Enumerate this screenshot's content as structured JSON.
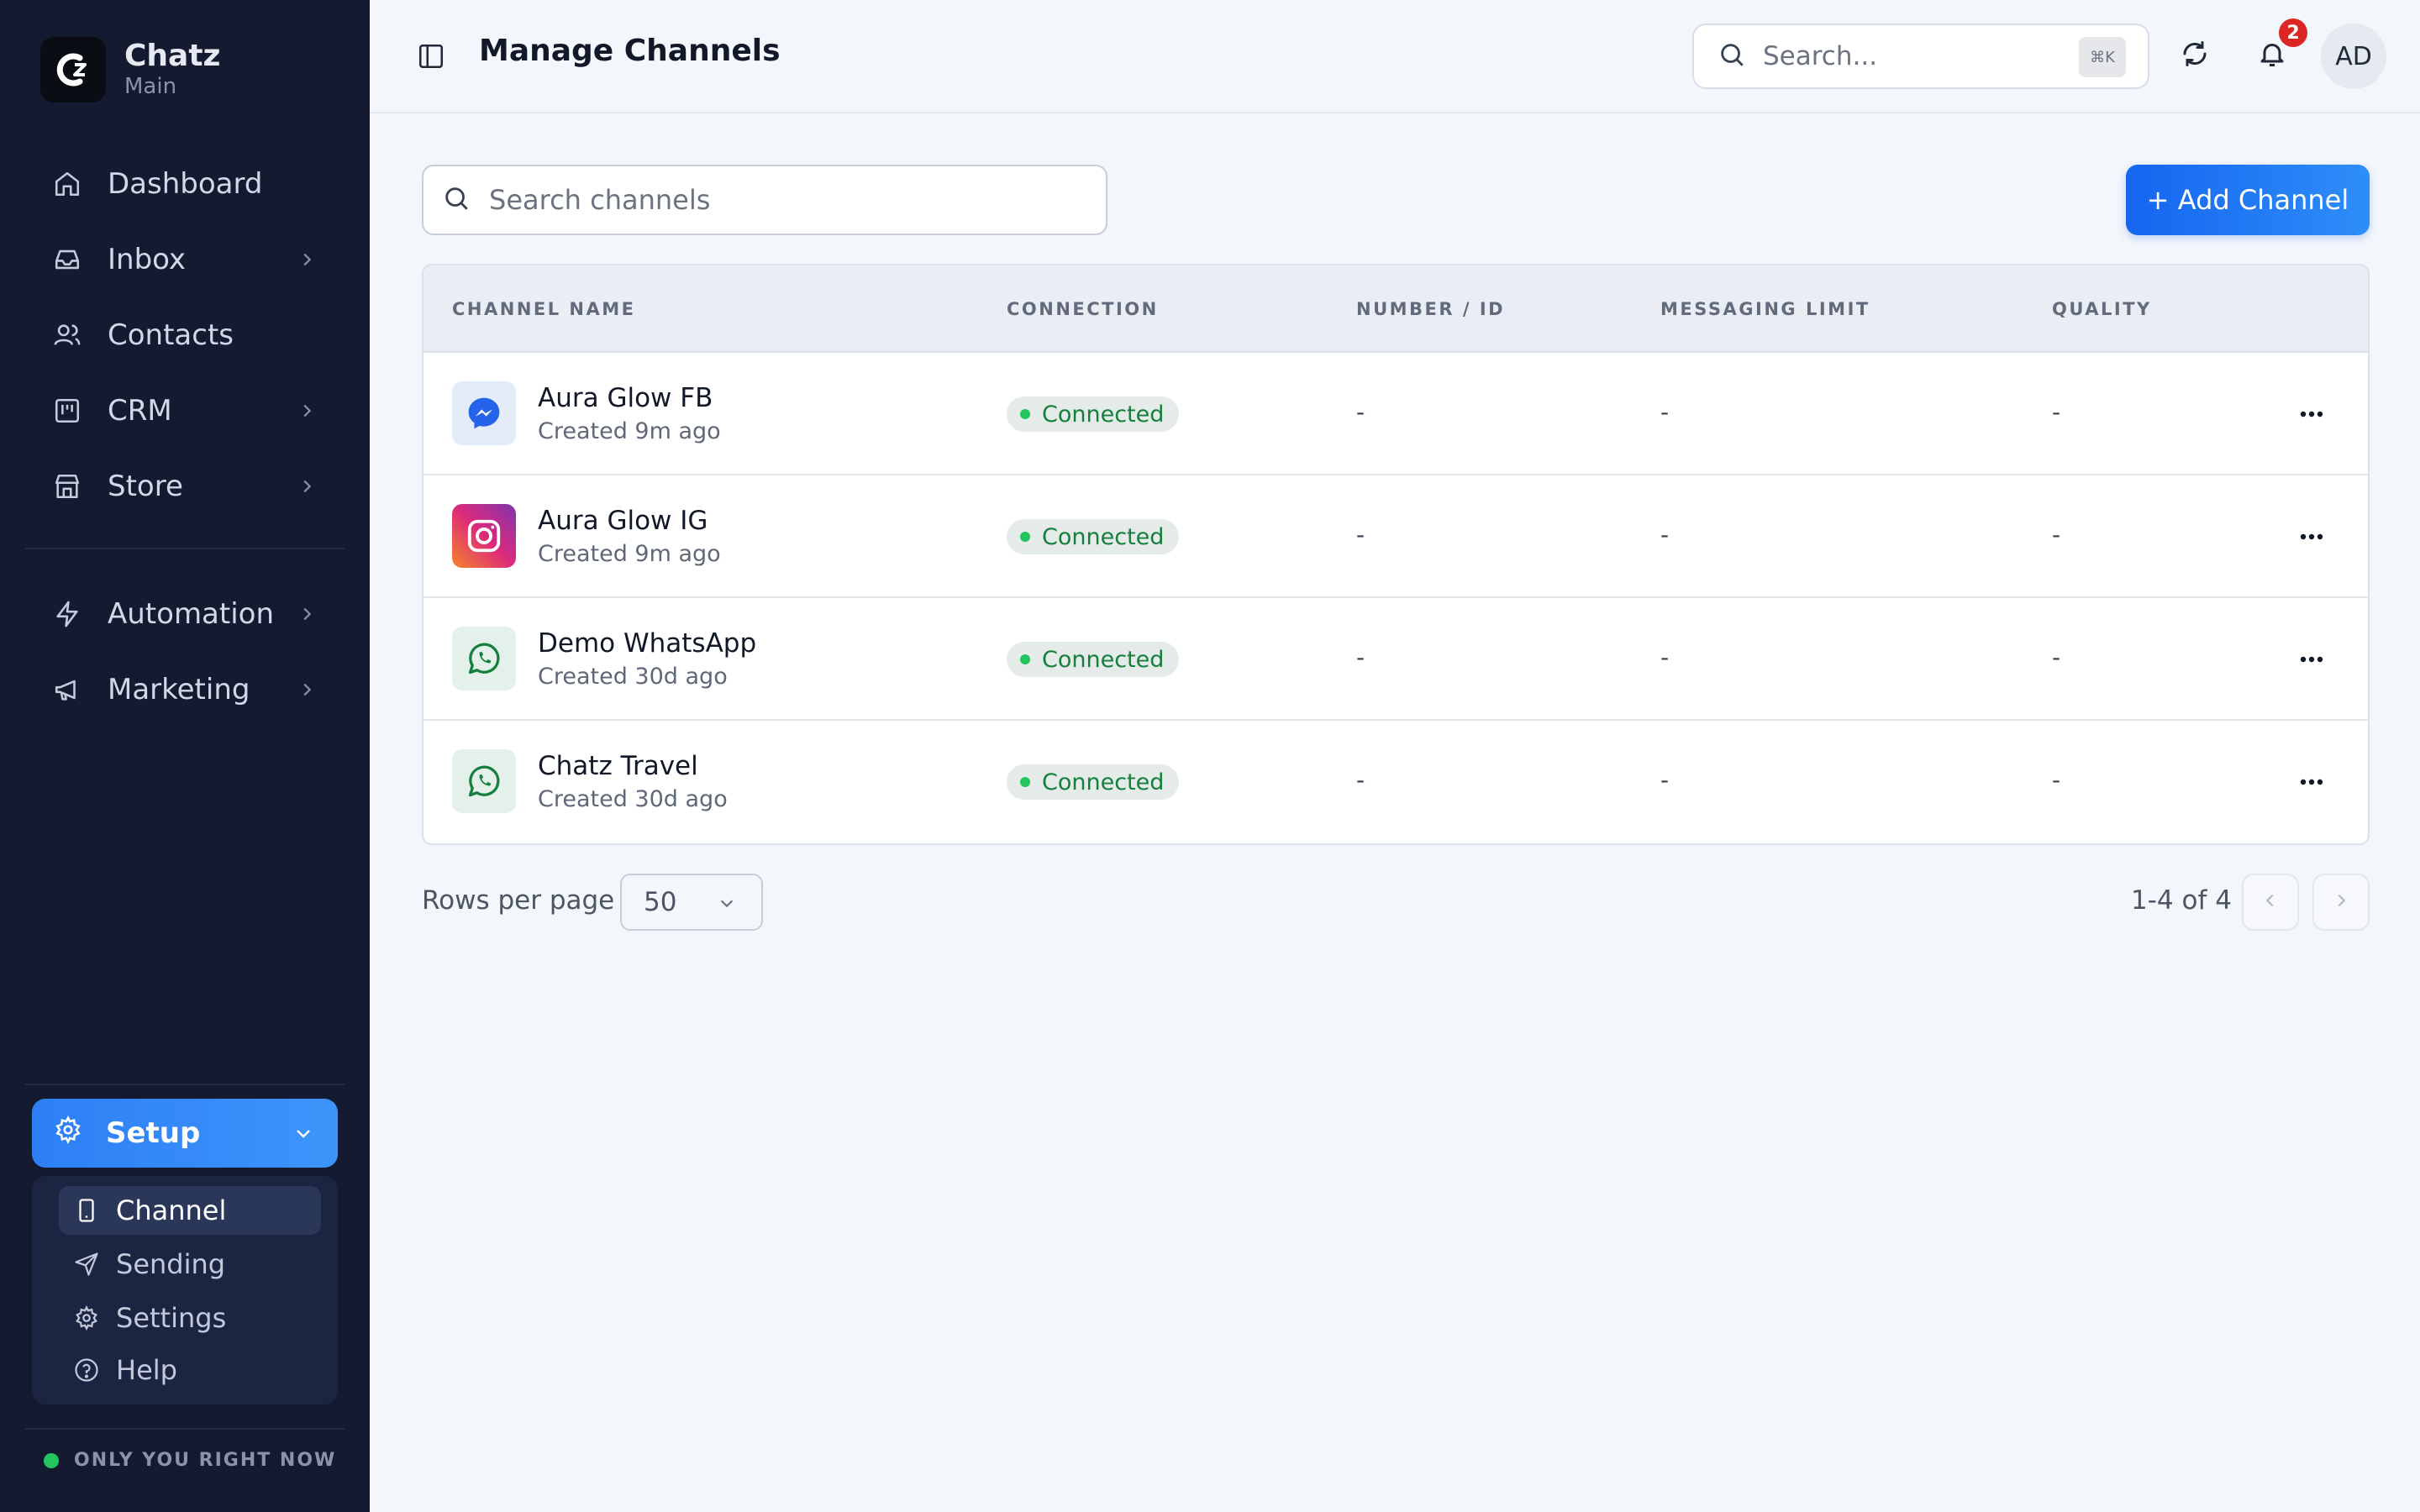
{
  "app": {
    "name": "Chatz",
    "workspace": "Main"
  },
  "sidebar": {
    "items": [
      {
        "label": "Dashboard",
        "icon": "home-icon"
      },
      {
        "label": "Inbox",
        "icon": "inbox-icon"
      },
      {
        "label": "Contacts",
        "icon": "users-icon"
      },
      {
        "label": "CRM",
        "icon": "kanban-icon"
      },
      {
        "label": "Store",
        "icon": "store-icon"
      },
      {
        "label": "Automation",
        "icon": "lightning-icon"
      },
      {
        "label": "Marketing",
        "icon": "megaphone-icon"
      }
    ],
    "setup": {
      "label": "Setup",
      "subitems": [
        {
          "label": "Channel",
          "icon": "phone-icon",
          "active": true
        },
        {
          "label": "Sending",
          "icon": "send-icon"
        },
        {
          "label": "Settings",
          "icon": "gear-icon"
        },
        {
          "label": "Help",
          "icon": "help-icon"
        }
      ]
    },
    "presence": "ONLY YOU RIGHT NOW"
  },
  "header": {
    "title": "Manage Channels",
    "search_placeholder": "Search...",
    "shortcut": "⌘K",
    "notification_count": "2",
    "avatar_initials": "AD"
  },
  "main": {
    "search_placeholder": "Search channels",
    "add_button": "+ Add Channel",
    "columns": [
      "CHANNEL NAME",
      "CONNECTION",
      "NUMBER / ID",
      "MESSAGING LIMIT",
      "QUALITY"
    ],
    "rows": [
      {
        "name": "Aura Glow FB",
        "created": "Created 9m ago",
        "type": "messenger",
        "connection": "Connected",
        "number": "-",
        "limit": "-",
        "quality": "-"
      },
      {
        "name": "Aura Glow IG",
        "created": "Created 9m ago",
        "type": "instagram",
        "connection": "Connected",
        "number": "-",
        "limit": "-",
        "quality": "-"
      },
      {
        "name": "Demo WhatsApp",
        "created": "Created 30d ago",
        "type": "whatsapp",
        "connection": "Connected",
        "number": "-",
        "limit": "-",
        "quality": "-"
      },
      {
        "name": "Chatz Travel",
        "created": "Created 30d ago",
        "type": "whatsapp",
        "connection": "Connected",
        "number": "-",
        "limit": "-",
        "quality": "-"
      }
    ],
    "pagination": {
      "rows_label": "Rows per page",
      "rows_value": "50",
      "range": "1-4 of 4"
    }
  },
  "colors": {
    "sidebar_bg": "#141a30",
    "accent": "#2d7ff5",
    "connected": "#15803d",
    "badge": "#dc2626"
  }
}
